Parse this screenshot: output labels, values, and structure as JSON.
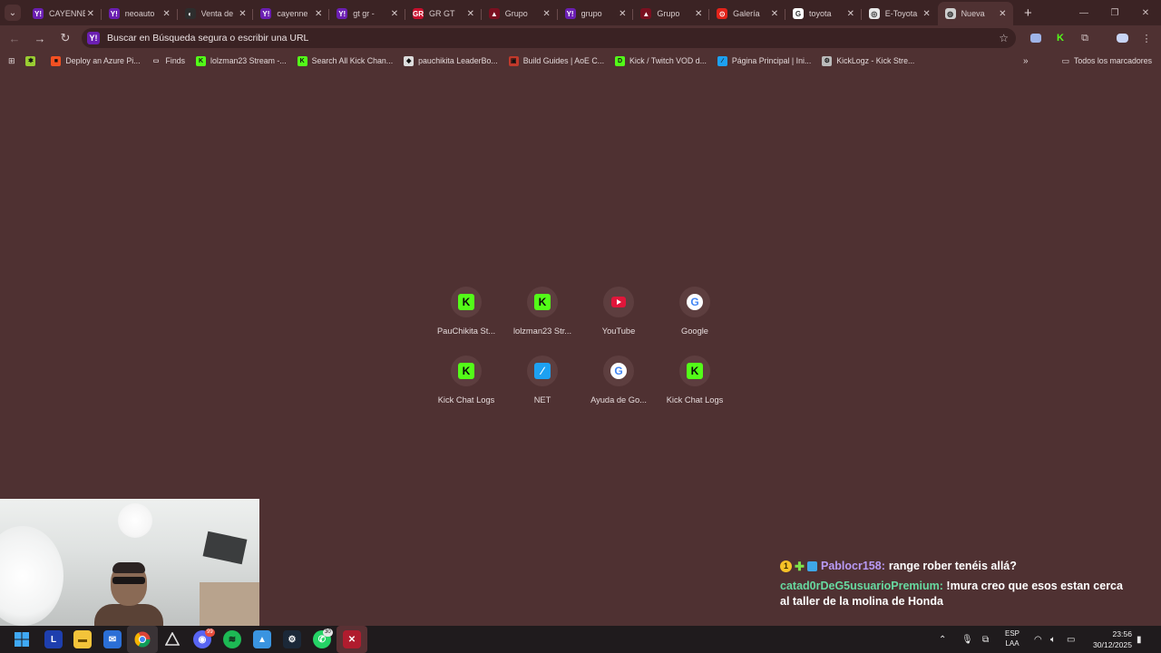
{
  "browser": {
    "tabs": [
      {
        "title": "CAYENNE",
        "color": "#6b1fb2",
        "glyph": "Y!",
        "active": false
      },
      {
        "title": "neoauto",
        "color": "#6b1fb2",
        "glyph": "Y!",
        "active": false
      },
      {
        "title": "Venta de",
        "color": "#2d2d2d",
        "glyph": "◐",
        "active": false
      },
      {
        "title": "cayenne",
        "color": "#6b1fb2",
        "glyph": "Y!",
        "active": false
      },
      {
        "title": "gt gr -",
        "color": "#6b1fb2",
        "glyph": "Y!",
        "active": false
      },
      {
        "title": "GR GT",
        "color": "#c8102e",
        "glyph": "GR",
        "active": false
      },
      {
        "title": "Grupo",
        "color": "#7a1020",
        "glyph": "▲",
        "active": false
      },
      {
        "title": "grupo",
        "color": "#6b1fb2",
        "glyph": "Y!",
        "active": false
      },
      {
        "title": "Grupo",
        "color": "#7a1020",
        "glyph": "▲",
        "active": false
      },
      {
        "title": "Galería",
        "color": "#e2231a",
        "glyph": "⊙",
        "active": false
      },
      {
        "title": "toyota",
        "color": "#ffffff",
        "glyph": "G",
        "active": false
      },
      {
        "title": "E-Toyota",
        "color": "#e8e8e8",
        "glyph": "◎",
        "active": false
      },
      {
        "title": "Nueva",
        "color": "#cfcfcf",
        "glyph": "◍",
        "active": true
      }
    ],
    "new_tab_glyph": "+",
    "omnibox_placeholder": "Buscar en Búsqueda segura o escribir una URL",
    "bookmarks": [
      {
        "label": "",
        "color": "#9acd32",
        "glyph": "✱"
      },
      {
        "label": "Deploy an Azure Pi...",
        "color": "#f25022",
        "glyph": "■"
      },
      {
        "label": "Finds",
        "color": "transparent",
        "glyph": "▭"
      },
      {
        "label": "lolzman23 Stream -...",
        "color": "#53fc18",
        "glyph": "K"
      },
      {
        "label": "Search All Kick Chan...",
        "color": "#53fc18",
        "glyph": "K"
      },
      {
        "label": "pauchikita LeaderBo...",
        "color": "#dddddd",
        "glyph": "◆"
      },
      {
        "label": "Build Guides | AoE C...",
        "color": "#c0392b",
        "glyph": "▣"
      },
      {
        "label": "Kick / Twitch VOD d...",
        "color": "#53fc18",
        "glyph": "D"
      },
      {
        "label": "Página Principal | Ini...",
        "color": "#1da1f2",
        "glyph": "∕"
      },
      {
        "label": "KickLogz - Kick Stre...",
        "color": "#bbbbbb",
        "glyph": "⚙"
      }
    ],
    "all_bookmarks_label": "Todos los marcadores"
  },
  "shortcuts": [
    {
      "label": "PauChikita St...",
      "type": "k",
      "glyph": "K"
    },
    {
      "label": "lolzman23 Str...",
      "type": "k",
      "glyph": "K"
    },
    {
      "label": "YouTube",
      "type": "yt",
      "glyph": "▶"
    },
    {
      "label": "Google",
      "type": "g",
      "glyph": "G"
    },
    {
      "label": "Kick Chat Logs",
      "type": "k",
      "glyph": "K"
    },
    {
      "label": "NET",
      "type": "net",
      "glyph": "∕"
    },
    {
      "label": "Ayuda de Go...",
      "type": "g",
      "glyph": "G"
    },
    {
      "label": "Kick Chat Logs",
      "type": "k",
      "glyph": "K"
    }
  ],
  "chat": {
    "msg1_badges": [
      "1",
      "✚",
      ""
    ],
    "msg1_user": "Pablocr158:",
    "msg1_text": "range rober tenéis allá?",
    "msg2_user": "catad0rDeG5usuarioPremium:",
    "msg2_text": "!mura creo que esos estan cerca al taller de la molina de Honda"
  },
  "taskbar": {
    "lang_line1": "ESP",
    "lang_line2": "LAA",
    "time": "23:56",
    "date": "30/12/2025",
    "discord_badge": "99",
    "whatsapp_badge": "30"
  }
}
